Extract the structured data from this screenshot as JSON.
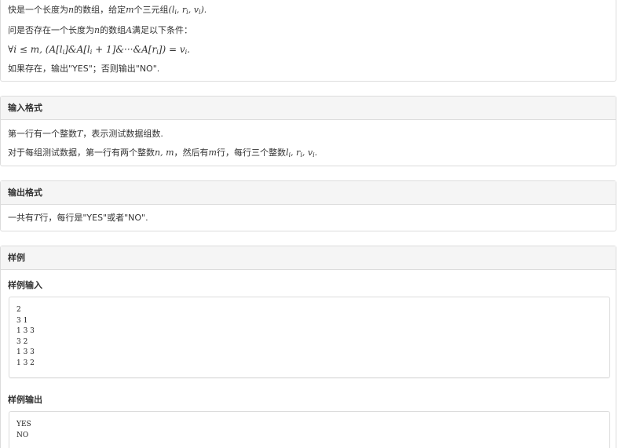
{
  "description": {
    "line1_prefix": "快是一个长度为",
    "line1_var_n": "n",
    "line1_mid1": "的数组，给定",
    "line1_var_m": "m",
    "line1_mid2": "个三元组",
    "line1_triple": "(l",
    "line1_triple_sub_i1": "i",
    "line1_triple_r": ", r",
    "line1_triple_sub_i2": "i",
    "line1_triple_v": ", v",
    "line1_triple_sub_i3": "i",
    "line1_triple_end": ").",
    "line2_prefix": "问是否存在一个长度为",
    "line2_var_n": "n",
    "line2_mid": "的数组",
    "line2_var_A": "A",
    "line2_suffix": "满足以下条件：",
    "formula": "∀i ≤ m, (A[l",
    "formula_sub1": "i",
    "formula_mid": "]&A[l",
    "formula_sub2": "i",
    "formula_mid2": " + 1]&···&A[r",
    "formula_sub3": "i",
    "formula_end": "]) = v",
    "formula_sub4": "i",
    "formula_tail": ".",
    "line4": "如果存在，输出\"YES\"；否则输出\"NO\"."
  },
  "input_section": {
    "title": "输入格式",
    "line1_prefix": "第一行有一个整数",
    "line1_var": "T",
    "line1_suffix": "，表示测试数据组数.",
    "line2_prefix": "对于每组测试数据，第一行有两个整数",
    "line2_vars": "n, m",
    "line2_mid": "，然后有",
    "line2_var_m": "m",
    "line2_mid2": "行，每行三个整数",
    "line2_l": "l",
    "line2_sub1": "i",
    "line2_r": ", r",
    "line2_sub2": "i",
    "line2_v": ", v",
    "line2_sub3": "i",
    "line2_end": "."
  },
  "output_section": {
    "title": "输出格式",
    "line1_prefix": "一共有",
    "line1_var": "T",
    "line1_suffix": "行，每行是\"YES\"或者\"NO\"."
  },
  "sample_section": {
    "title": "样例",
    "input_title": "样例输入",
    "input_lines": [
      "2",
      "3 1",
      "1 3 3",
      "3 2",
      "1 3 3",
      "1 3 2"
    ],
    "output_title": "样例输出",
    "output_lines": [
      "YES",
      "NO"
    ]
  }
}
